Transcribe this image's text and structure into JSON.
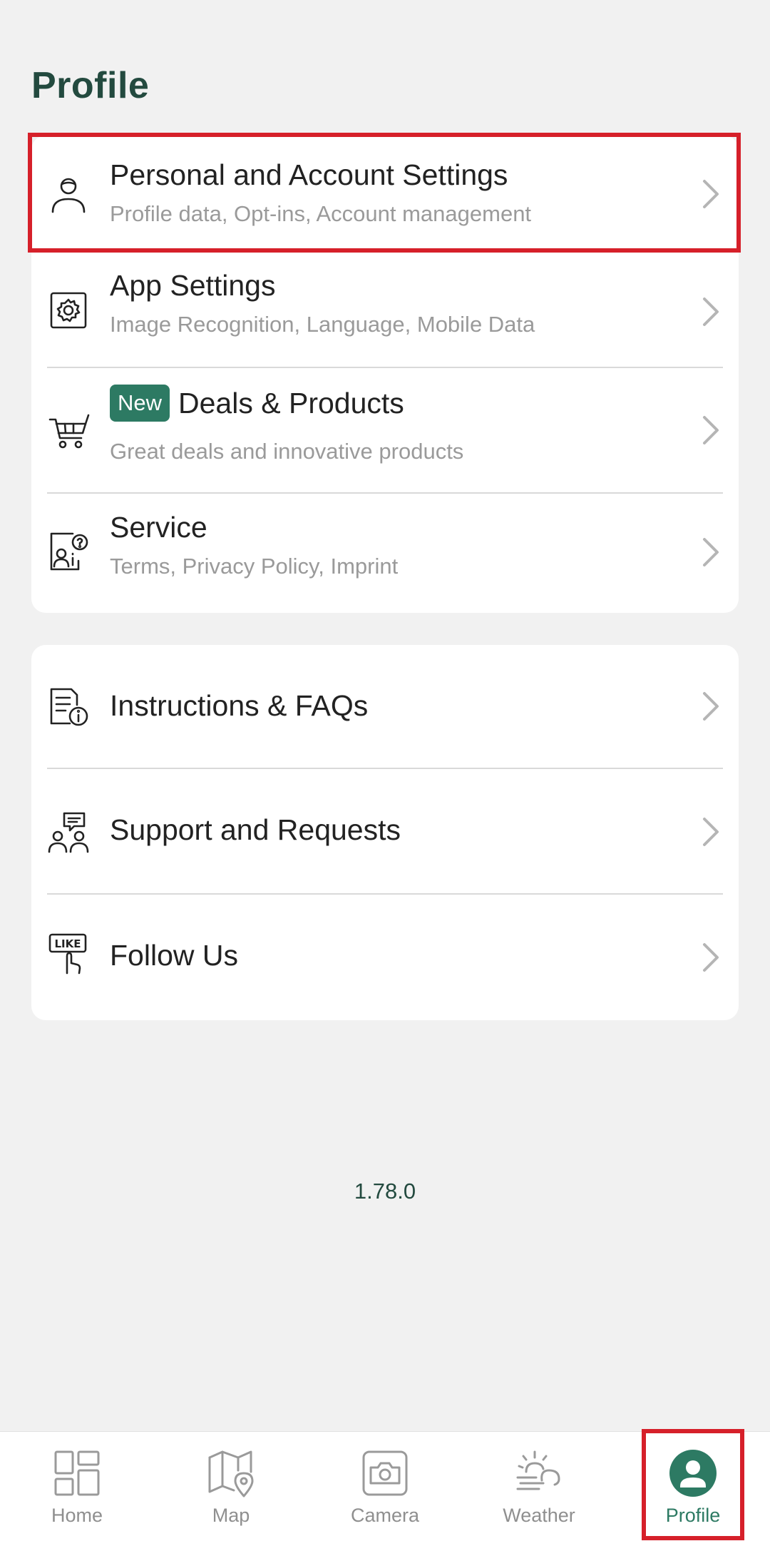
{
  "header": {
    "title": "Profile"
  },
  "accent_color": "#2d7a63",
  "highlight_color": "#d6202a",
  "menu_group_1": {
    "items": [
      {
        "icon": "person-icon",
        "title": "Personal and Account Settings",
        "subtitle": "Profile data, Opt-ins, Account management"
      },
      {
        "icon": "settings-gear-icon",
        "title": "App Settings",
        "subtitle": "Image Recognition, Language, Mobile Data"
      },
      {
        "icon": "shopping-cart-icon",
        "badge": "New",
        "title": "Deals & Products",
        "subtitle": "Great deals and innovative products"
      },
      {
        "icon": "service-support-icon",
        "title": "Service",
        "subtitle": "Terms, Privacy Policy, Imprint"
      }
    ]
  },
  "menu_group_2": {
    "items": [
      {
        "icon": "document-info-icon",
        "title": "Instructions & FAQs"
      },
      {
        "icon": "support-people-icon",
        "title": "Support and Requests"
      },
      {
        "icon": "like-hand-icon",
        "title": "Follow Us"
      }
    ]
  },
  "version": "1.78.0",
  "bottom_nav": {
    "items": [
      {
        "label": "Home",
        "icon": "home-grid-icon",
        "active": false
      },
      {
        "label": "Map",
        "icon": "map-icon",
        "active": false
      },
      {
        "label": "Camera",
        "icon": "camera-icon",
        "active": false
      },
      {
        "label": "Weather",
        "icon": "weather-icon",
        "active": false
      },
      {
        "label": "Profile",
        "icon": "profile-avatar-icon",
        "active": true
      }
    ]
  }
}
